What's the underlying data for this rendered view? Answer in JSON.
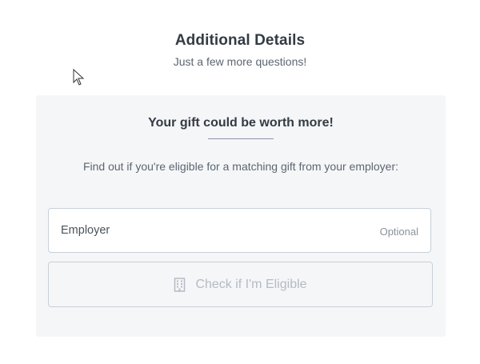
{
  "header": {
    "title": "Additional Details",
    "subtitle": "Just a few more questions!"
  },
  "matching_gift": {
    "title": "Your gift could be worth more!",
    "description": "Find out if you're eligible for a matching gift from your employer:",
    "employer_field": {
      "label": "Employer",
      "optional_label": "Optional",
      "value": ""
    },
    "check_button": {
      "label": "Check if I'm Eligible",
      "icon": "building-icon"
    }
  },
  "colors": {
    "title_text": "#333b44",
    "muted_text": "#5c6670",
    "card_background": "#f5f6f8",
    "field_border": "#c9d0d8",
    "disabled_button_text": "#b4bbc3"
  }
}
